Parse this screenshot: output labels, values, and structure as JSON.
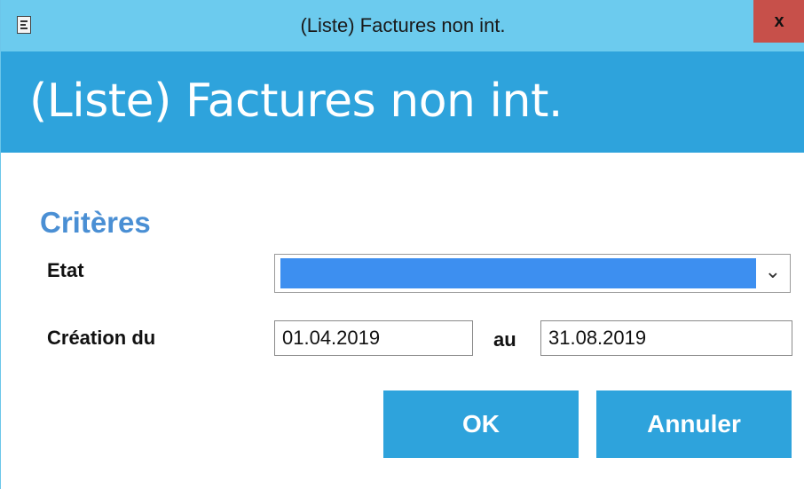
{
  "window": {
    "title": "(Liste) Factures non int.",
    "close_label": "x"
  },
  "header": {
    "title": "(Liste) Factures non int."
  },
  "criteria": {
    "section_title": "Critères",
    "etat": {
      "label": "Etat",
      "value": ""
    },
    "creation": {
      "label": "Création du",
      "from": "01.04.2019",
      "to_label": "au",
      "to": "31.08.2019"
    }
  },
  "buttons": {
    "ok": "OK",
    "cancel": "Annuler"
  },
  "colors": {
    "titlebar": "#6ccbee",
    "header": "#2ea3dc",
    "accent_text": "#4a8fd4",
    "close": "#c7504a",
    "selection": "#3d8ff0"
  },
  "icons": {
    "app": "document-icon",
    "dropdown": "chevron-down-icon"
  }
}
